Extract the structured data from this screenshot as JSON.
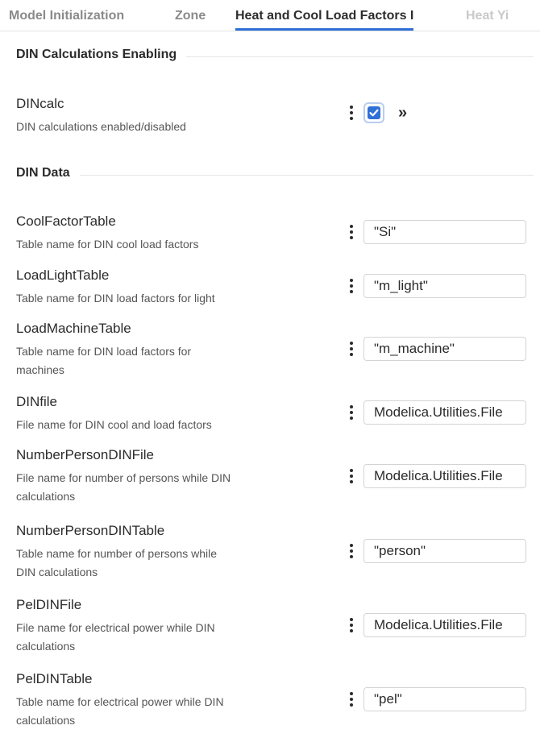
{
  "tabs": [
    {
      "label": "Model Initialization",
      "state": "inactive"
    },
    {
      "label": "Zone",
      "state": "inactive"
    },
    {
      "label": "Heat and Cool Load Factors I",
      "state": "active"
    },
    {
      "label": "Heat Yi",
      "state": "faded"
    }
  ],
  "sections": {
    "enabling": {
      "title": "DIN Calculations Enabling"
    },
    "data": {
      "title": "DIN Data"
    }
  },
  "din_calc": {
    "name": "DINcalc",
    "description": "DIN calculations enabled/disabled",
    "checked": true,
    "menu_icon": "kebab-menu-icon",
    "expand_icon": "double-chevron-right-icon",
    "expand_glyph": "»"
  },
  "parameters": [
    {
      "name": "CoolFactorTable",
      "desc_lines": [
        "Table name for DIN cool load factors"
      ],
      "value": "\"Si\""
    },
    {
      "name": "LoadLightTable",
      "desc_lines": [
        "Table name for DIN load factors for light"
      ],
      "value": "\"m_light\""
    },
    {
      "name": "LoadMachineTable",
      "desc_lines": [
        "Table name for DIN load factors for",
        "machines"
      ],
      "value": "\"m_machine\""
    },
    {
      "name": "DINfile",
      "desc_lines": [
        "File name for DIN cool and load factors"
      ],
      "value": "Modelica.Utilities.File"
    },
    {
      "name": "NumberPersonDINFile",
      "desc_lines": [
        "File name for number of persons while DIN",
        "calculations"
      ],
      "value": "Modelica.Utilities.File"
    },
    {
      "name": "NumberPersonDINTable",
      "desc_lines": [
        "Table name for number of persons while",
        "DIN calculations"
      ],
      "value": "\"person\""
    },
    {
      "name": "PelDINFile",
      "desc_lines": [
        "File name for electrical power while DIN",
        "calculations"
      ],
      "value": "Modelica.Utilities.File"
    },
    {
      "name": "PelDINTable",
      "desc_lines": [
        "Table name for electrical power while DIN",
        "calculations"
      ],
      "value": "\"pel\""
    }
  ],
  "colors": {
    "accent": "#2f6fd6",
    "inactive_tab": "#8a8a8a"
  }
}
